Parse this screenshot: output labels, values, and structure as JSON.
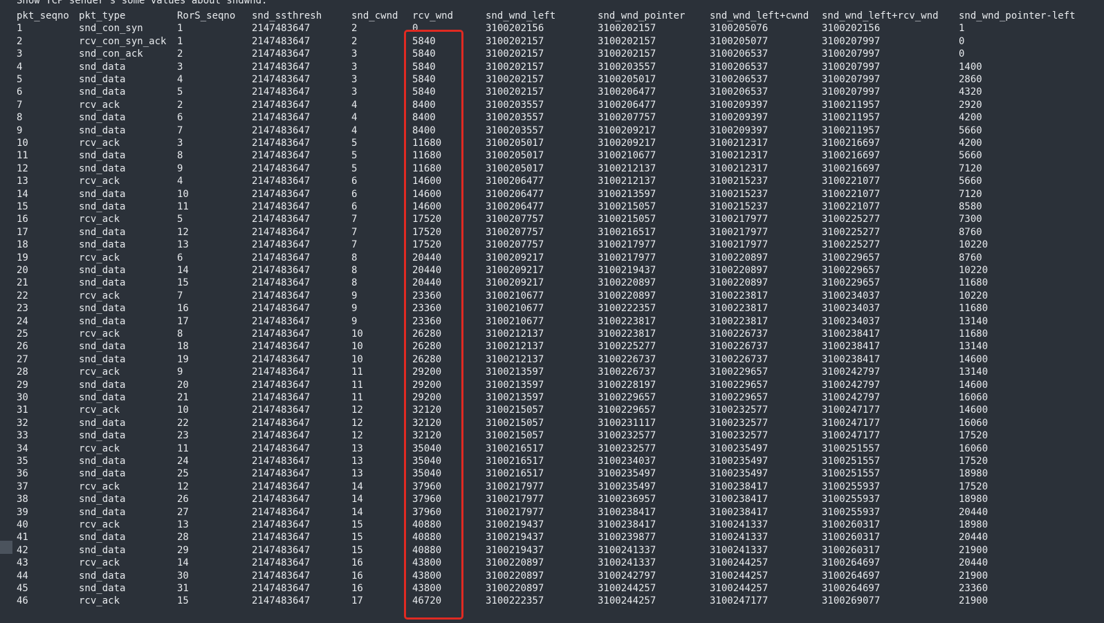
{
  "caption": "Show TCP sender's some values about sndwnd:",
  "columns": [
    "pkt_seqno",
    "pkt_type",
    "RorS_seqno",
    "snd_ssthresh",
    "snd_cwnd",
    "rcv_wnd",
    "snd_wnd_left",
    "snd_wnd_pointer",
    "snd_wnd_left+cwnd",
    "snd_wnd_left+rcv_wnd",
    "snd_wnd_pointer-left"
  ],
  "rows": [
    [
      "1",
      "snd_con_syn",
      "1",
      "2147483647",
      "2",
      "0",
      "3100202156",
      "3100202157",
      "3100205076",
      "3100202156",
      "1"
    ],
    [
      "2",
      "rcv_con_syn_ack",
      "1",
      "2147483647",
      "2",
      "5840",
      "3100202157",
      "3100202157",
      "3100205077",
      "3100207997",
      "0"
    ],
    [
      "3",
      "snd_con_ack",
      "2",
      "2147483647",
      "3",
      "5840",
      "3100202157",
      "3100202157",
      "3100206537",
      "3100207997",
      "0"
    ],
    [
      "4",
      "snd_data",
      "3",
      "2147483647",
      "3",
      "5840",
      "3100202157",
      "3100203557",
      "3100206537",
      "3100207997",
      "1400"
    ],
    [
      "5",
      "snd_data",
      "4",
      "2147483647",
      "3",
      "5840",
      "3100202157",
      "3100205017",
      "3100206537",
      "3100207997",
      "2860"
    ],
    [
      "6",
      "snd_data",
      "5",
      "2147483647",
      "3",
      "5840",
      "3100202157",
      "3100206477",
      "3100206537",
      "3100207997",
      "4320"
    ],
    [
      "7",
      "rcv_ack",
      "2",
      "2147483647",
      "4",
      "8400",
      "3100203557",
      "3100206477",
      "3100209397",
      "3100211957",
      "2920"
    ],
    [
      "8",
      "snd_data",
      "6",
      "2147483647",
      "4",
      "8400",
      "3100203557",
      "3100207757",
      "3100209397",
      "3100211957",
      "4200"
    ],
    [
      "9",
      "snd_data",
      "7",
      "2147483647",
      "4",
      "8400",
      "3100203557",
      "3100209217",
      "3100209397",
      "3100211957",
      "5660"
    ],
    [
      "10",
      "rcv_ack",
      "3",
      "2147483647",
      "5",
      "11680",
      "3100205017",
      "3100209217",
      "3100212317",
      "3100216697",
      "4200"
    ],
    [
      "11",
      "snd_data",
      "8",
      "2147483647",
      "5",
      "11680",
      "3100205017",
      "3100210677",
      "3100212317",
      "3100216697",
      "5660"
    ],
    [
      "12",
      "snd_data",
      "9",
      "2147483647",
      "5",
      "11680",
      "3100205017",
      "3100212137",
      "3100212317",
      "3100216697",
      "7120"
    ],
    [
      "13",
      "rcv_ack",
      "4",
      "2147483647",
      "6",
      "14600",
      "3100206477",
      "3100212137",
      "3100215237",
      "3100221077",
      "5660"
    ],
    [
      "14",
      "snd_data",
      "10",
      "2147483647",
      "6",
      "14600",
      "3100206477",
      "3100213597",
      "3100215237",
      "3100221077",
      "7120"
    ],
    [
      "15",
      "snd_data",
      "11",
      "2147483647",
      "6",
      "14600",
      "3100206477",
      "3100215057",
      "3100215237",
      "3100221077",
      "8580"
    ],
    [
      "16",
      "rcv_ack",
      "5",
      "2147483647",
      "7",
      "17520",
      "3100207757",
      "3100215057",
      "3100217977",
      "3100225277",
      "7300"
    ],
    [
      "17",
      "snd_data",
      "12",
      "2147483647",
      "7",
      "17520",
      "3100207757",
      "3100216517",
      "3100217977",
      "3100225277",
      "8760"
    ],
    [
      "18",
      "snd_data",
      "13",
      "2147483647",
      "7",
      "17520",
      "3100207757",
      "3100217977",
      "3100217977",
      "3100225277",
      "10220"
    ],
    [
      "19",
      "rcv_ack",
      "6",
      "2147483647",
      "8",
      "20440",
      "3100209217",
      "3100217977",
      "3100220897",
      "3100229657",
      "8760"
    ],
    [
      "20",
      "snd_data",
      "14",
      "2147483647",
      "8",
      "20440",
      "3100209217",
      "3100219437",
      "3100220897",
      "3100229657",
      "10220"
    ],
    [
      "21",
      "snd_data",
      "15",
      "2147483647",
      "8",
      "20440",
      "3100209217",
      "3100220897",
      "3100220897",
      "3100229657",
      "11680"
    ],
    [
      "22",
      "rcv_ack",
      "7",
      "2147483647",
      "9",
      "23360",
      "3100210677",
      "3100220897",
      "3100223817",
      "3100234037",
      "10220"
    ],
    [
      "23",
      "snd_data",
      "16",
      "2147483647",
      "9",
      "23360",
      "3100210677",
      "3100222357",
      "3100223817",
      "3100234037",
      "11680"
    ],
    [
      "24",
      "snd_data",
      "17",
      "2147483647",
      "9",
      "23360",
      "3100210677",
      "3100223817",
      "3100223817",
      "3100234037",
      "13140"
    ],
    [
      "25",
      "rcv_ack",
      "8",
      "2147483647",
      "10",
      "26280",
      "3100212137",
      "3100223817",
      "3100226737",
      "3100238417",
      "11680"
    ],
    [
      "26",
      "snd_data",
      "18",
      "2147483647",
      "10",
      "26280",
      "3100212137",
      "3100225277",
      "3100226737",
      "3100238417",
      "13140"
    ],
    [
      "27",
      "snd_data",
      "19",
      "2147483647",
      "10",
      "26280",
      "3100212137",
      "3100226737",
      "3100226737",
      "3100238417",
      "14600"
    ],
    [
      "28",
      "rcv_ack",
      "9",
      "2147483647",
      "11",
      "29200",
      "3100213597",
      "3100226737",
      "3100229657",
      "3100242797",
      "13140"
    ],
    [
      "29",
      "snd_data",
      "20",
      "2147483647",
      "11",
      "29200",
      "3100213597",
      "3100228197",
      "3100229657",
      "3100242797",
      "14600"
    ],
    [
      "30",
      "snd_data",
      "21",
      "2147483647",
      "11",
      "29200",
      "3100213597",
      "3100229657",
      "3100229657",
      "3100242797",
      "16060"
    ],
    [
      "31",
      "rcv_ack",
      "10",
      "2147483647",
      "12",
      "32120",
      "3100215057",
      "3100229657",
      "3100232577",
      "3100247177",
      "14600"
    ],
    [
      "32",
      "snd_data",
      "22",
      "2147483647",
      "12",
      "32120",
      "3100215057",
      "3100231117",
      "3100232577",
      "3100247177",
      "16060"
    ],
    [
      "33",
      "snd_data",
      "23",
      "2147483647",
      "12",
      "32120",
      "3100215057",
      "3100232577",
      "3100232577",
      "3100247177",
      "17520"
    ],
    [
      "34",
      "rcv_ack",
      "11",
      "2147483647",
      "13",
      "35040",
      "3100216517",
      "3100232577",
      "3100235497",
      "3100251557",
      "16060"
    ],
    [
      "35",
      "snd_data",
      "24",
      "2147483647",
      "13",
      "35040",
      "3100216517",
      "3100234037",
      "3100235497",
      "3100251557",
      "17520"
    ],
    [
      "36",
      "snd_data",
      "25",
      "2147483647",
      "13",
      "35040",
      "3100216517",
      "3100235497",
      "3100235497",
      "3100251557",
      "18980"
    ],
    [
      "37",
      "rcv_ack",
      "12",
      "2147483647",
      "14",
      "37960",
      "3100217977",
      "3100235497",
      "3100238417",
      "3100255937",
      "17520"
    ],
    [
      "38",
      "snd_data",
      "26",
      "2147483647",
      "14",
      "37960",
      "3100217977",
      "3100236957",
      "3100238417",
      "3100255937",
      "18980"
    ],
    [
      "39",
      "snd_data",
      "27",
      "2147483647",
      "14",
      "37960",
      "3100217977",
      "3100238417",
      "3100238417",
      "3100255937",
      "20440"
    ],
    [
      "40",
      "rcv_ack",
      "13",
      "2147483647",
      "15",
      "40880",
      "3100219437",
      "3100238417",
      "3100241337",
      "3100260317",
      "18980"
    ],
    [
      "41",
      "snd_data",
      "28",
      "2147483647",
      "15",
      "40880",
      "3100219437",
      "3100239877",
      "3100241337",
      "3100260317",
      "20440"
    ],
    [
      "42",
      "snd_data",
      "29",
      "2147483647",
      "15",
      "40880",
      "3100219437",
      "3100241337",
      "3100241337",
      "3100260317",
      "21900"
    ],
    [
      "43",
      "rcv_ack",
      "14",
      "2147483647",
      "16",
      "43800",
      "3100220897",
      "3100241337",
      "3100244257",
      "3100264697",
      "20440"
    ],
    [
      "44",
      "snd_data",
      "30",
      "2147483647",
      "16",
      "43800",
      "3100220897",
      "3100242797",
      "3100244257",
      "3100264697",
      "21900"
    ],
    [
      "45",
      "snd_data",
      "31",
      "2147483647",
      "16",
      "43800",
      "3100220897",
      "3100244257",
      "3100244257",
      "3100264697",
      "23360"
    ],
    [
      "46",
      "rcv_ack",
      "15",
      "2147483647",
      "17",
      "46720",
      "3100222357",
      "3100244257",
      "3100247177",
      "3100269077",
      "21900"
    ]
  ],
  "colors": {
    "background": "#2b3139",
    "text": "#e8ebee",
    "highlight_border": "#e02a22",
    "gutter_marker": "#4b535d"
  }
}
